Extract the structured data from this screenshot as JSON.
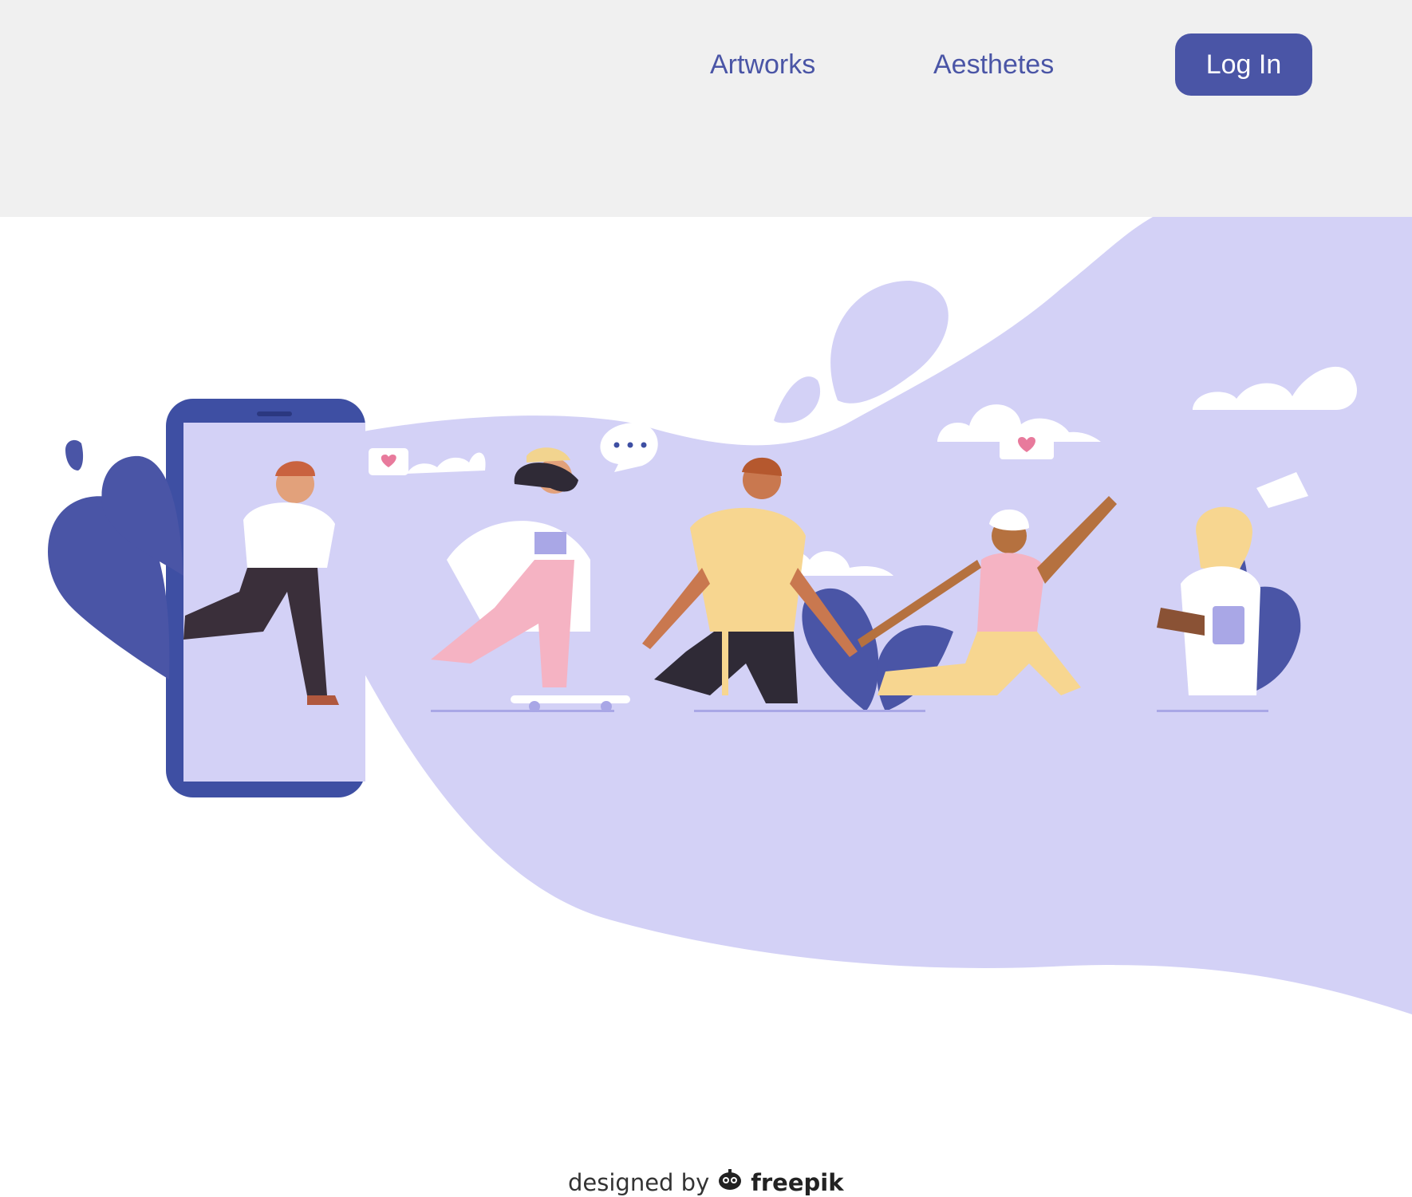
{
  "nav": {
    "links": [
      {
        "label": "Artworks"
      },
      {
        "label": "Aesthetes"
      }
    ],
    "login_label": "Log In"
  },
  "hero": {
    "credit_text": "designed by",
    "credit_brand": "freepik"
  },
  "colors": {
    "header_bg": "#f0f0f0",
    "accent": "#4a55a6",
    "lavender": "#d3d1f6",
    "phone": "#3e4fa3"
  }
}
